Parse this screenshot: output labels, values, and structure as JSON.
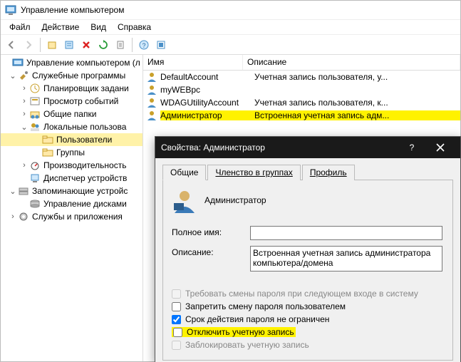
{
  "window": {
    "title": "Управление компьютером"
  },
  "menu": {
    "file": "Файл",
    "action": "Действие",
    "view": "Вид",
    "help": "Справка"
  },
  "tree": {
    "root": "Управление компьютером (л",
    "system_tools": "Служебные программы",
    "task_scheduler": "Планировщик задани",
    "event_viewer": "Просмотр событий",
    "shared_folders": "Общие папки",
    "local_users": "Локальные пользова",
    "users": "Пользователи",
    "groups": "Группы",
    "performance": "Производительность",
    "device_manager": "Диспетчер устройств",
    "storage": "Запоминающие устройс",
    "disk_mgmt": "Управление дисками",
    "services": "Службы и приложения"
  },
  "list": {
    "col_name": "Имя",
    "col_desc": "Описание",
    "rows": [
      {
        "name": "DefaultAccount",
        "desc": "Учетная запись пользователя, у..."
      },
      {
        "name": "myWEBpc",
        "desc": ""
      },
      {
        "name": "WDAGUtilityAccount",
        "desc": "Учетная запись пользователя, к..."
      },
      {
        "name": "Администратор",
        "desc": "Встроенная учетная запись адм..."
      }
    ]
  },
  "dialog": {
    "title": "Свойства: Администратор",
    "tab_general": "Общие",
    "tab_memberof": "Членство в группах",
    "tab_profile": "Профиль",
    "user_name": "Администратор",
    "label_fullname": "Полное имя:",
    "value_fullname": "",
    "label_description": "Описание:",
    "value_description": "Встроенная учетная запись администратора компьютера/домена",
    "chk_mustchange": "Требовать смены пароля при следующем входе в систему",
    "chk_cannotchange": "Запретить смену пароля пользователем",
    "chk_neverexpires": "Срок действия пароля не ограничен",
    "chk_disabled": "Отключить учетную запись",
    "chk_locked": "Заблокировать учетную запись"
  }
}
